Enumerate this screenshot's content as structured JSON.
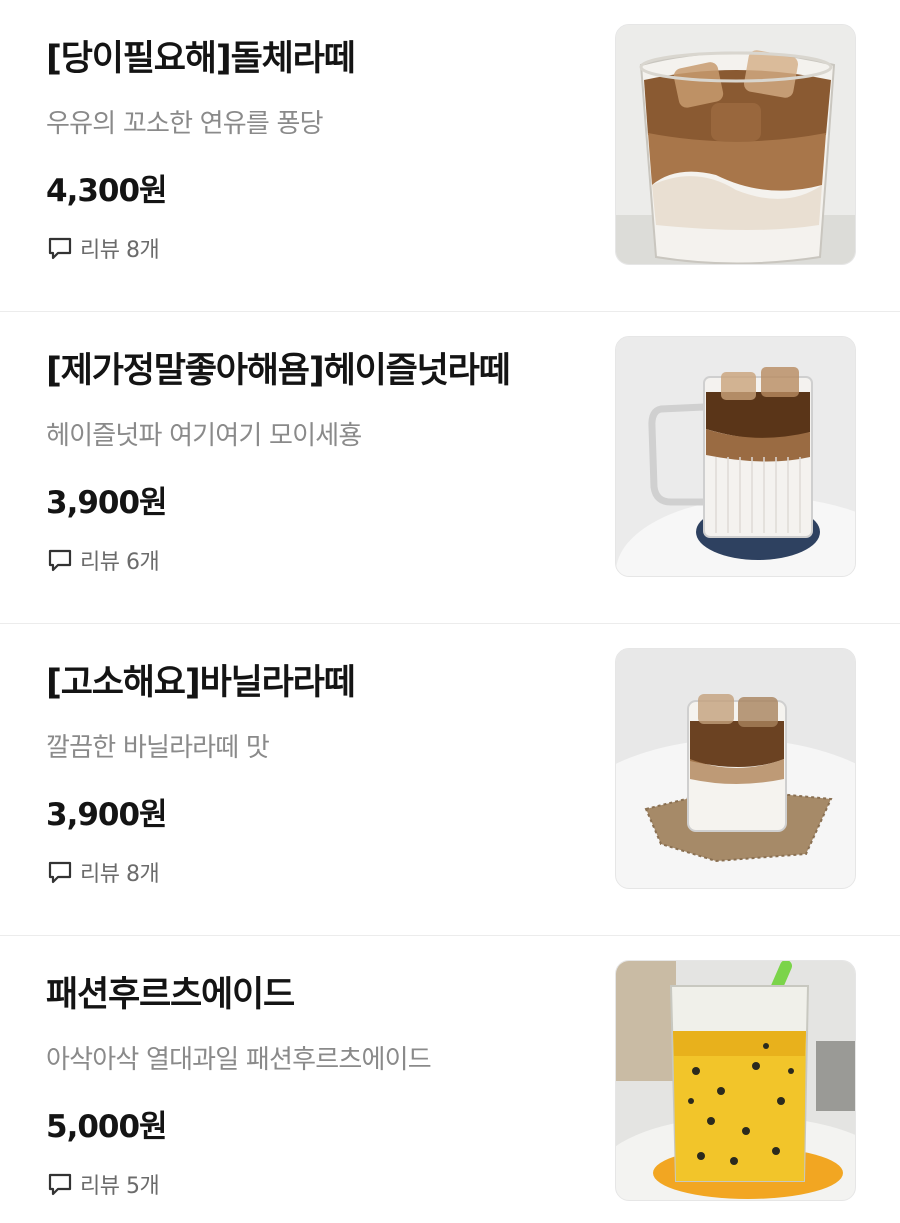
{
  "menu": {
    "items": [
      {
        "name": "[당이필요해]돌체라떼",
        "description": "우유의 꼬소한 연유를 퐁당",
        "price": "4,300원",
        "review_label": "리뷰 8개",
        "photo": "dolce-latte-iced-glass"
      },
      {
        "name": "[제가정말좋아해욤]헤이즐넛라떼",
        "description": "헤이즐넛파 여기여기 모이세횽",
        "price": "3,900원",
        "review_label": "리뷰 6개",
        "photo": "hazelnut-latte-mug"
      },
      {
        "name": "[고소해요]바닐라라떼",
        "description": "깔끔한 바닐라라떼 맛",
        "price": "3,900원",
        "review_label": "리뷰 8개",
        "photo": "vanilla-latte-glass"
      },
      {
        "name": "패션후르츠에이드",
        "description": "아삭아삭 열대과일 패션후르츠에이드",
        "price": "5,000원",
        "review_label": "리뷰 5개",
        "photo": "passionfruit-ade-glass"
      }
    ]
  },
  "colors": {
    "name_text": "#141414",
    "description_text": "#8a8a8a",
    "review_text": "#6b6b6b",
    "divider": "#ececec"
  },
  "icons": {
    "review": "speech-bubble-icon"
  }
}
